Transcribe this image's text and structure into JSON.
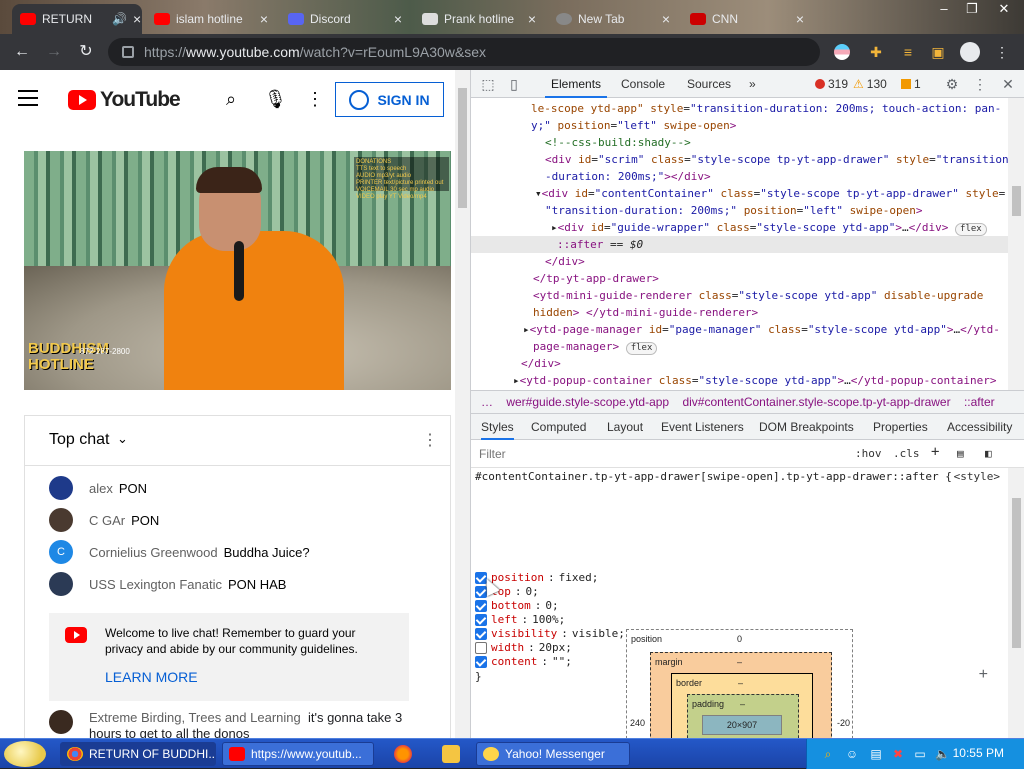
{
  "browser": {
    "tabs": [
      {
        "label": "RETURN",
        "active": true,
        "color": "#ff0000"
      },
      {
        "label": "islam hotline",
        "active": false,
        "color": "#ff0000"
      },
      {
        "label": "Discord",
        "active": false,
        "color": "#5865f2"
      },
      {
        "label": "Prank hotline",
        "active": false,
        "color": "#dddddd"
      },
      {
        "label": "New Tab",
        "active": false,
        "color": "#888888"
      },
      {
        "label": "CNN",
        "active": false,
        "color": "#cc0000"
      }
    ],
    "url_prefix": "https://",
    "url_host": "www.youtube.com",
    "url_rest": "/watch?v=rEoumL9A30w&sex",
    "tab_close": "×"
  },
  "youtube": {
    "logo_text": "YouTube",
    "signin_label": "SIGN IN",
    "video": {
      "overlay_logo": "BUDDHISM\nHOTLINE",
      "overlay_phone": "872-287-2800",
      "overlay_donations": "DONATIONS\nTTS text to speech\nAUDIO mp3/yt audio\nPRINTER text/picture printed out\nVOICEMAIL 30 sec mp audio\nVIDEO play YT Video/mp4"
    },
    "chat": {
      "title": "Top chat",
      "messages": [
        {
          "author": "alex",
          "text": "PON",
          "avatar_color": "#1e3a8a",
          "initial": ""
        },
        {
          "author": "C GAr",
          "text": "PON",
          "avatar_color": "#4a3a30",
          "initial": ""
        },
        {
          "author": "Cornielius Greenwood",
          "text": "Buddha Juice?",
          "avatar_color": "#1e88e5",
          "initial": "C"
        },
        {
          "author": "USS Lexington Fanatic",
          "text": "PON HAB",
          "avatar_color": "#2b3a55",
          "initial": ""
        }
      ],
      "welcome": "Welcome to live chat! Remember to guard your privacy and abide by our community guidelines.",
      "learn_more": "LEARN MORE",
      "last_author": "Extreme Birding, Trees and Learning",
      "last_text": "it's gonna take 3 hours to get to all the donos"
    }
  },
  "devtools": {
    "tabs": [
      "Elements",
      "Console",
      "Sources",
      "»"
    ],
    "errors": "319",
    "warnings": "130",
    "issues": "1",
    "dom": [
      {
        "html": "<span class='an'>le-scope ytd-app\"</span> <span class='an'>style</span>=<span class='av'>\"transition-duration: 200ms; touch-action: pan-</span>"
      },
      {
        "html": "<span class='av'>y;\"</span> <span class='an'>position</span>=<span class='av'>\"left\"</span> <span class='an'>swipe-open</span><span class='t'>&gt;</span>"
      },
      {
        "html": "<span class='cm'>&lt;!--css-build:shady--&gt;</span>"
      },
      {
        "html": "<span class='t'>&lt;div</span> <span class='an'>id</span>=<span class='av'>\"scrim\"</span> <span class='an'>class</span>=<span class='av'>\"style-scope tp-yt-app-drawer\"</span> <span class='an'>style</span>=<span class='av'>\"transition</span>"
      },
      {
        "html": "<span class='av'>-duration: 200ms;\"</span><span class='t'>&gt;&lt;/div&gt;</span>"
      },
      {
        "html": "<span class='tx'>▾</span><span class='t'>&lt;div</span> <span class='an'>id</span>=<span class='av'>\"contentContainer\"</span> <span class='an'>class</span>=<span class='av'>\"style-scope tp-yt-app-drawer\"</span> <span class='an'>style</span>="
      },
      {
        "html": "<span class='av'>\"transition-duration: 200ms;\"</span> <span class='an'>position</span>=<span class='av'>\"left\"</span> <span class='an'>swipe-open</span><span class='t'>&gt;</span>"
      },
      {
        "html": "<span class='tx'>▸</span><span class='t'>&lt;div</span> <span class='an'>id</span>=<span class='av'>\"guide-wrapper\"</span> <span class='an'>class</span>=<span class='av'>\"style-scope ytd-app\"</span><span class='t'>&gt;</span>…<span class='t'>&lt;/div&gt;</span> <span class='flex'>flex</span>"
      },
      {
        "html": "<span class='t'>::after</span> <span class='tx'>== <i>$0</i></span>"
      },
      {
        "html": "<span class='t'>&lt;/div&gt;</span>"
      },
      {
        "html": "<span class='t'>&lt;/tp-yt-app-drawer&gt;</span>"
      },
      {
        "html": "<span class='t'>&lt;ytd-mini-guide-renderer</span> <span class='an'>class</span>=<span class='av'>\"style-scope ytd-app\"</span> <span class='an'>disable-upgrade</span>"
      },
      {
        "html": "<span class='an'>hidden</span><span class='t'>&gt; &lt;/ytd-mini-guide-renderer&gt;</span>"
      },
      {
        "html": "<span class='tx'>▸</span><span class='t'>&lt;ytd-page-manager</span> <span class='an'>id</span>=<span class='av'>\"page-manager\"</span> <span class='an'>class</span>=<span class='av'>\"style-scope ytd-app\"</span><span class='t'>&gt;</span>…<span class='t'>&lt;/ytd-</span>"
      },
      {
        "html": "<span class='t'>page-manager&gt;</span> <span class='flex'>flex</span>"
      },
      {
        "html": "<span class='t'>&lt;/div&gt;</span>"
      },
      {
        "html": "<span class='tx'>▸</span><span class='t'>&lt;ytd-popup-container</span> <span class='an'>class</span>=<span class='av'>\"style-scope ytd-app\"</span><span class='t'>&gt;</span>…<span class='t'>&lt;/ytd-popup-container&gt;</span>"
      }
    ],
    "crumbs": [
      "…",
      "wer#guide.style-scope.ytd-app",
      "div#contentContainer.style-scope.tp-yt-app-drawer",
      "::after"
    ],
    "style_tabs": [
      "Styles",
      "Computed",
      "Layout",
      "Event Listeners",
      "DOM Breakpoints",
      "Properties",
      "Accessibility"
    ],
    "filter_placeholder": "Filter",
    "hov": ":hov",
    "cls": ".cls",
    "selector": "#contentContainer.tp-yt-app-drawer[swipe-open].tp-yt-app-drawer::after {",
    "source": "<style>",
    "props": [
      {
        "name": "position",
        "value": "fixed;",
        "checked": true
      },
      {
        "name": "top",
        "value": "0;",
        "checked": true
      },
      {
        "name": "bottom",
        "value": "0;",
        "checked": true
      },
      {
        "name": "left",
        "value": "100%;",
        "checked": true
      },
      {
        "name": "visibility",
        "value": "visible;",
        "checked": true
      },
      {
        "name": "width",
        "value": "20px;",
        "checked": false
      },
      {
        "name": "content",
        "value": "\"\";",
        "checked": true
      }
    ],
    "close_brace": "}",
    "boxmodel": {
      "position_label": "position",
      "position_value": "0",
      "margin_label": "margin",
      "margin_value": "–",
      "border_label": "border",
      "border_value": "–",
      "padding_label": "padding",
      "padding_value": "–",
      "content": "20×907",
      "left": "240",
      "right": "-20"
    }
  },
  "taskbar": {
    "tasks": [
      {
        "label": "RETURN OF BUDDHI...",
        "color": "#ffffff"
      },
      {
        "label": "https://www.youtub...",
        "color": "#ff0000"
      },
      {
        "label": "Yahoo! Messenger",
        "color": "#ffd54a"
      }
    ],
    "clock": "10:55 PM"
  }
}
